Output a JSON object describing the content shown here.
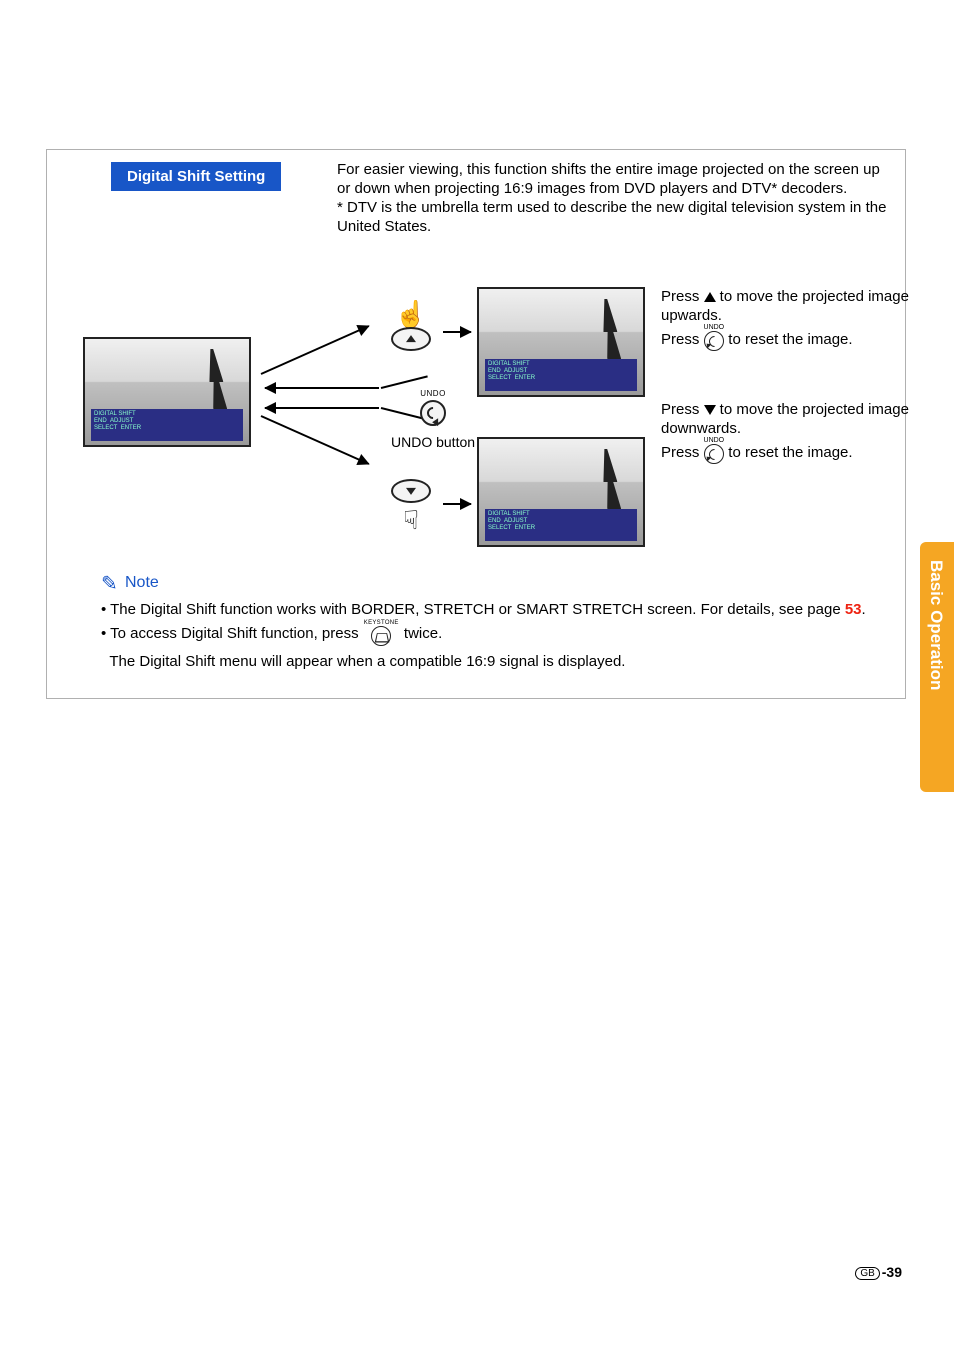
{
  "side_tab": {
    "label": "Basic Operation"
  },
  "title": "Digital Shift Setting",
  "intro": {
    "line1": "For easier viewing, this function shifts the entire image projected on the screen up or down when projecting 16:9 images from DVD players and DTV* decoders.",
    "footnote": "* DTV is the umbrella term used to describe the new digital television system in the United States."
  },
  "overlay": {
    "title": "DIGITAL SHIFT",
    "end": "END",
    "adjust": "ADJUST",
    "select": "SELECT",
    "enter": "ENTER"
  },
  "controls": {
    "undo_tiny": "UNDO",
    "undo_label": "UNDO button",
    "keystone_tiny": "KEYSTONE"
  },
  "right": {
    "up_a": "Press ",
    "up_b": " to move the projected image upwards.",
    "press": "Press ",
    "reset": " to reset the image.",
    "dn_a": "Press ",
    "dn_b": " to move the projected image downwards."
  },
  "note": {
    "heading": "Note",
    "n1a": "• The Digital Shift function works with BORDER, STRETCH or SMART STRETCH screen. For details, see page ",
    "pref": "53",
    "n1b": ".",
    "n2a": "• To access Digital Shift function, press ",
    "n2b": " twice.",
    "n2c": "The Digital Shift menu will appear when a compatible 16:9 signal is displayed."
  },
  "page_number": {
    "gb": "GB",
    "num": "-39"
  }
}
